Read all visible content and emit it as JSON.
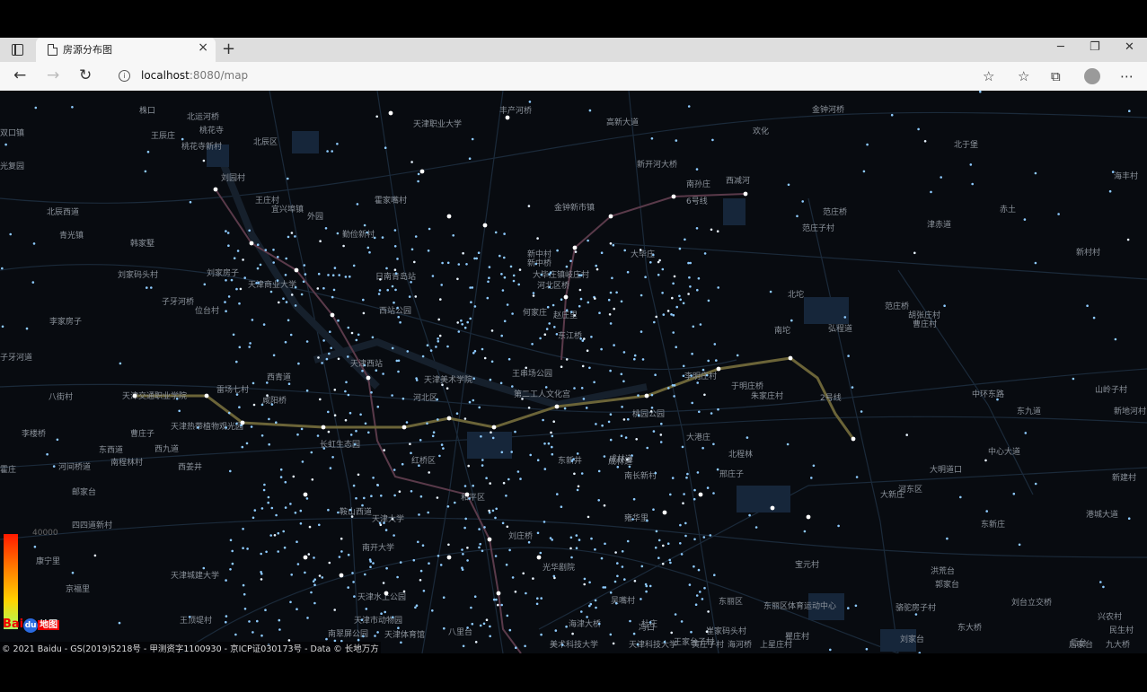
{
  "browser": {
    "tab_title": "房源分布图",
    "url_host": "localhost",
    "url_rest": ":8080/map",
    "new_tab": "+",
    "close": "×",
    "min": "─",
    "max": "❐",
    "winclose": "✕",
    "back": "←",
    "forward": "→",
    "reload": "↻",
    "info_glyph": "i",
    "star": "☆",
    "favorites": "☆",
    "collections": "⧉",
    "more": "⋯"
  },
  "map": {
    "legend_max": "40000",
    "copyright": "© 2021 Baidu - GS(2019)5218号 - 甲测资字1100930 - 京ICP证030173号 - Data © 长地万方",
    "logo_bai": "Bai",
    "logo_du": "du",
    "logo_map": "地图",
    "labels": [
      "株口",
      "北运河桥",
      "王辰庄",
      "桃花寺",
      "桃花寺新村",
      "北辰区",
      "丰产河桥",
      "天津职业大学",
      "高新大道",
      "金钟河桥",
      "欢化",
      "北于堡",
      "海丰村",
      "双口镇",
      "光复园",
      "刘园村",
      "新开河大桥",
      "南孙庄",
      "西减河",
      "王庄村",
      "宜兴埠镇",
      "金钟新市镇",
      "6号线",
      "北辰西道",
      "青光镇",
      "霍家嘴村",
      "外园",
      "范庄桥",
      "范庄子村",
      "津赤道",
      "赤土",
      "新村村",
      "韩家墅",
      "勤俭新村",
      "新中村",
      "新中桥",
      "大毕庄",
      "刘家码头村",
      "刘家房子",
      "天津商业大学",
      "日南青岛站",
      "大毕庄镇岐庄村",
      "河北区桥",
      "李家房子",
      "子牙河桥",
      "位台村",
      "西站公园",
      "何家庄",
      "赵庄里",
      "北坨",
      "范庄桥",
      "胡张庄村",
      "曹庄村",
      "弘程道",
      "东江桥",
      "南坨",
      "子牙河道",
      "天津西站",
      "天津美术学院",
      "王串场公园",
      "李明庄村",
      "于明庄桥",
      "中环东路",
      "东九道",
      "山岭子村",
      "八街村",
      "西青道",
      "河北区",
      "雷场七村",
      "朱家庄村",
      "天津交通职业学院",
      "咸阳桥",
      "第二工人文化宫",
      "2号线",
      "新地河村",
      "李楼桥",
      "天津热带植物观光园",
      "桃园公园",
      "成林道",
      "大港庄",
      "曹庄子",
      "长虹生态园",
      "红桥区",
      "北程林",
      "中心大道",
      "东西道",
      "邢庄子",
      "大明道口",
      "河东区",
      "南程林村",
      "西九道",
      "东新井",
      "西姜井",
      "成林道",
      "大新庄",
      "霍庄",
      "南长新村",
      "新建村",
      "河间桥道",
      "邮家台",
      "和平区",
      "港城大道",
      "鞍山西道",
      "天津大学",
      "雍华里",
      "四四道新村",
      "康宁里",
      "刘庄桥",
      "南开大学",
      "东新庄",
      "天津城建大学",
      "光华剧院",
      "宝元村",
      "洪荒台",
      "京福里",
      "郭家台",
      "天津水上公园",
      "吴嘴村",
      "东丽区",
      "东丽区体育运动中心",
      "刘台立交桥",
      "兴农村",
      "王顶堤村",
      "天津市动物园",
      "海津大桥",
      "杜庄",
      "骆驼房子村",
      "东大桥",
      "民生村",
      "天津体育馆",
      "冯口",
      "崔家码头村",
      "后台",
      "九大桥",
      "南翠屏公园",
      "八里台",
      "王家台子村",
      "瞿庄村",
      "刘家台",
      "后家台",
      "黄庄子村",
      "海河桥",
      "上星庄村",
      "天津科技大学",
      "美术科技大学"
    ]
  }
}
